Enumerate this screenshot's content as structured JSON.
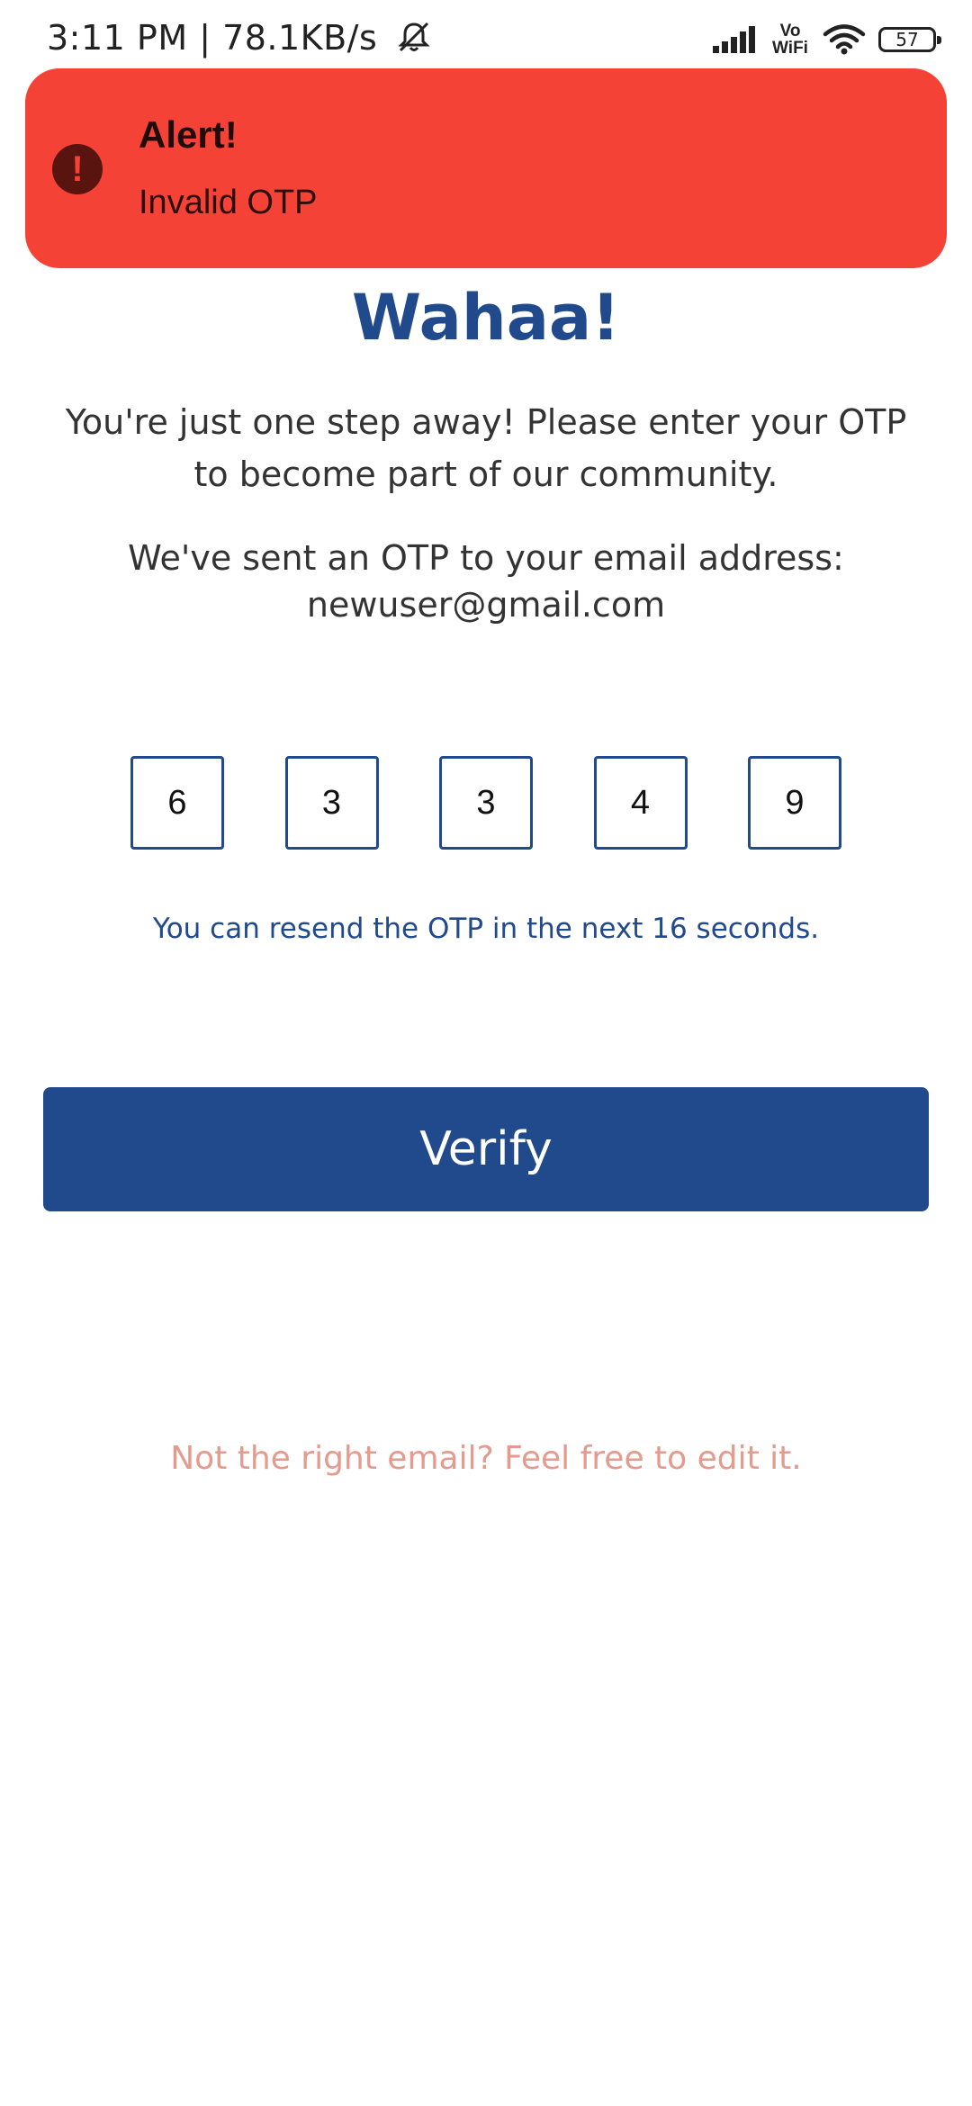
{
  "status_bar": {
    "time_speed": "3:11 PM | 78.1KB/s",
    "vowifi_top": "Vo",
    "vowifi_bottom": "WiFi",
    "battery": "57",
    "icons": [
      "bell-muted-icon",
      "signal-icon",
      "wifi-icon",
      "battery-icon"
    ]
  },
  "alert": {
    "title": "Alert!",
    "message": "Invalid OTP",
    "icon": "alert-circle-icon",
    "color": "#f44336"
  },
  "main": {
    "title": "Wahaa!",
    "subtitle_line1": "You're just one step away! Please enter your OTP",
    "subtitle_line2": "to become part of our community.",
    "sent_line1": "We've sent an OTP to your email address:",
    "email": "newuser@gmail.com",
    "otp_digits": [
      "6",
      "3",
      "3",
      "4",
      "9"
    ],
    "resend_text": "You can resend the OTP in the next 16 seconds.",
    "verify_label": "Verify",
    "edit_email_link": "Not the right email? Feel free to edit it."
  },
  "colors": {
    "primary": "#214a8c",
    "alert": "#f44336",
    "link": "#e59a8e"
  }
}
